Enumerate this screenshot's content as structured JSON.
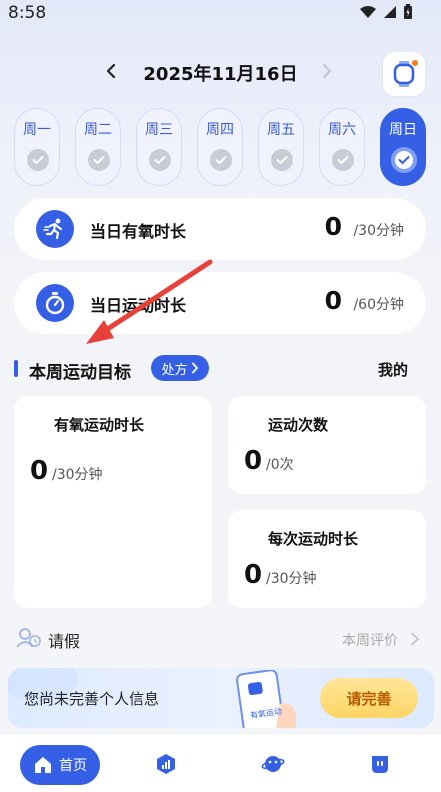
{
  "status_bar": {
    "time": "8:58"
  },
  "header": {
    "date": "2025年11月16日"
  },
  "week": [
    {
      "label": "周一",
      "active": false
    },
    {
      "label": "周二",
      "active": false
    },
    {
      "label": "周三",
      "active": false
    },
    {
      "label": "周四",
      "active": false
    },
    {
      "label": "周五",
      "active": false
    },
    {
      "label": "周六",
      "active": false
    },
    {
      "label": "周日",
      "active": true
    }
  ],
  "stats": [
    {
      "label": "当日有氧时长",
      "value": "0",
      "unit": "/30分钟",
      "icon": "running-icon"
    },
    {
      "label": "当日运动时长",
      "value": "0",
      "unit": "/60分钟",
      "icon": "stopwatch-icon"
    }
  ],
  "weekly_goal": {
    "title": "本周运动目标",
    "prescription_label": "处方",
    "mine_label": "我的",
    "aerobic": {
      "title": "有氧运动时长",
      "value": "0",
      "unit": "/30分钟"
    },
    "count": {
      "title": "运动次数",
      "value": "0",
      "unit": "/0次"
    },
    "per_session": {
      "title": "每次运动时长",
      "value": "0",
      "unit": "/30分钟"
    }
  },
  "leave": {
    "label": "请假",
    "eval_label": "本周评价"
  },
  "banner": {
    "text": "您尚未完善个人信息",
    "button": "请完善",
    "illus_text": "有氧运动"
  },
  "tabbar": {
    "home_label": "首页"
  },
  "colors": {
    "accent": "#3560e6",
    "arrow": "#e8413a"
  }
}
